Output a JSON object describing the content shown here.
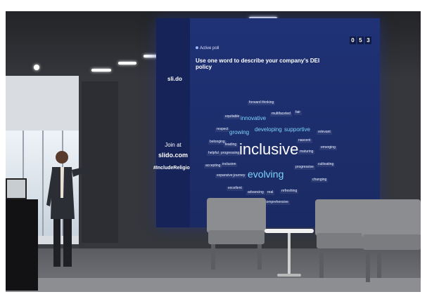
{
  "screen": {
    "brand": "sli.do",
    "join_text": "Join at",
    "join_url": "slido.com",
    "hashtag": "#IncludeReligion",
    "poll_label": "Active poll",
    "question": "Use one word to describe your company's DEI policy",
    "counter": [
      "0",
      "5",
      "3"
    ]
  },
  "word_cloud": [
    {
      "text": "forward thinking",
      "size": "small"
    },
    {
      "text": "equitable",
      "size": "small"
    },
    {
      "text": "innovative",
      "size": "medium"
    },
    {
      "text": "multifaceted",
      "size": "small"
    },
    {
      "text": "fair",
      "size": "small"
    },
    {
      "text": "respect",
      "size": "small"
    },
    {
      "text": "growing",
      "size": "medium"
    },
    {
      "text": "developing",
      "size": "medium"
    },
    {
      "text": "supportive",
      "size": "medium"
    },
    {
      "text": "relevant",
      "size": "small"
    },
    {
      "text": "belonging",
      "size": "small"
    },
    {
      "text": "leading",
      "size": "small"
    },
    {
      "text": "nascent",
      "size": "small"
    },
    {
      "text": "helpful",
      "size": "small"
    },
    {
      "text": "progressing",
      "size": "small"
    },
    {
      "text": "inclusive",
      "size": "xlarge"
    },
    {
      "text": "maturing",
      "size": "small"
    },
    {
      "text": "emerging",
      "size": "small"
    },
    {
      "text": "accepting",
      "size": "small"
    },
    {
      "text": "inclusion",
      "size": "small"
    },
    {
      "text": "progressive",
      "size": "small"
    },
    {
      "text": "cultivating",
      "size": "small"
    },
    {
      "text": "expansive",
      "size": "small"
    },
    {
      "text": "journey",
      "size": "small"
    },
    {
      "text": "evolving",
      "size": "large"
    },
    {
      "text": "changing",
      "size": "small"
    },
    {
      "text": "excellent",
      "size": "small"
    },
    {
      "text": "advancing",
      "size": "small"
    },
    {
      "text": "real",
      "size": "small"
    },
    {
      "text": "refreshing",
      "size": "small"
    },
    {
      "text": "comprehensive",
      "size": "small"
    }
  ],
  "colors": {
    "screen_bg": "#1b2a66",
    "word_highlight": "#7fd3ff",
    "word_default": "#e8eeff"
  }
}
